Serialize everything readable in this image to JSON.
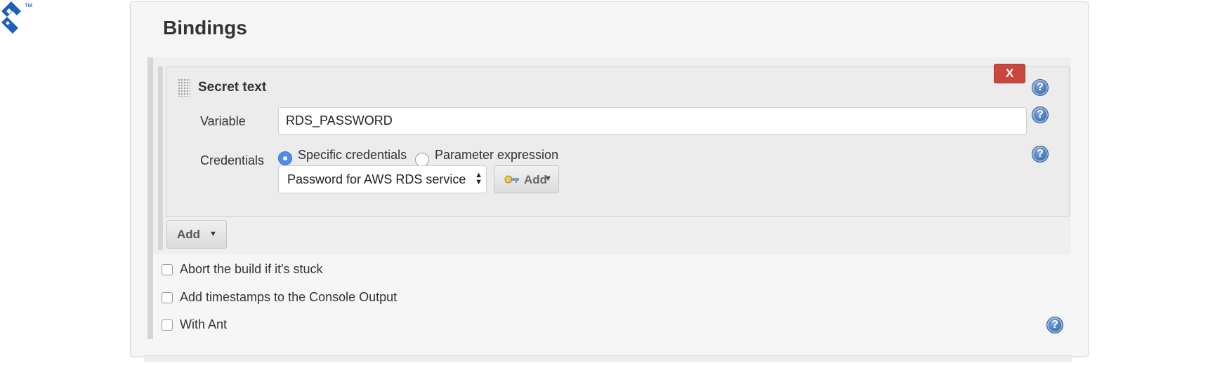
{
  "branding": {
    "trademark": "™",
    "logo_color": "#1b5fb8"
  },
  "section": {
    "title": "Bindings"
  },
  "binding": {
    "title": "Secret text",
    "delete_label": "X",
    "variable": {
      "label": "Variable",
      "value": "RDS_PASSWORD"
    },
    "credentials": {
      "label": "Credentials",
      "options": [
        "Specific credentials",
        "Parameter expression"
      ],
      "selected_option": "Specific credentials",
      "selected_credential": "Password for AWS RDS service",
      "add_label": "Add"
    }
  },
  "add_button": {
    "label": "Add"
  },
  "checkboxes": [
    {
      "label": "Abort the build if it's stuck",
      "checked": false
    },
    {
      "label": "Add timestamps to the Console Output",
      "checked": false
    },
    {
      "label": "With Ant",
      "checked": false
    }
  ],
  "icons": {
    "help": "help-icon",
    "drag": "drag-handle-icon",
    "key": "key-icon",
    "caret": "caret-down-icon",
    "select": "select-arrows-icon"
  },
  "colors": {
    "delete": "#c9473d",
    "help": "#3a6fb5",
    "radio_selected": "#4f8be8",
    "panel": "#f6f6f6"
  }
}
